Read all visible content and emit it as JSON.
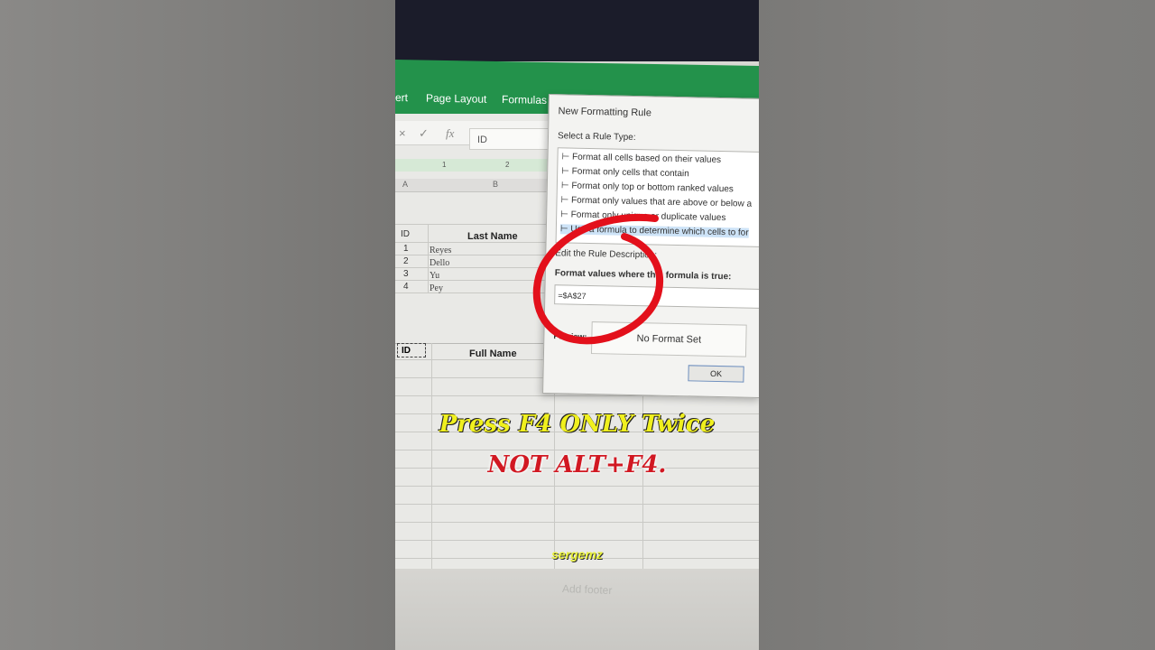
{
  "ribbon": {
    "tabs": [
      "ert",
      "Page Layout",
      "Formulas"
    ]
  },
  "formula_bar": {
    "cancel_icon": "×",
    "enter_icon": "✓",
    "fx_label": "fx",
    "value": "ID"
  },
  "ruler_marks": [
    "1",
    "2"
  ],
  "columns": [
    "A",
    "B"
  ],
  "table1": {
    "headers": [
      "ID",
      "Last Name"
    ],
    "rows": [
      {
        "id": "1",
        "last_name": "Reyes"
      },
      {
        "id": "2",
        "last_name": "Dello"
      },
      {
        "id": "3",
        "last_name": "Yu"
      },
      {
        "id": "4",
        "last_name": "Pey"
      }
    ]
  },
  "table2": {
    "headers": [
      "ID",
      "Full Name"
    ]
  },
  "dialog": {
    "title": "New Formatting Rule",
    "select_label": "Select a Rule Type:",
    "rule_types": [
      "Format all cells based on their values",
      "Format only cells that contain",
      "Format only top or bottom ranked values",
      "Format only values that are above or below a",
      "Format only unique or duplicate values",
      "Use a formula to determine which cells to for"
    ],
    "edit_label": "Edit the Rule Description:",
    "formula_label": "Format values where this formula is true:",
    "formula_value": "=$A$27",
    "preview_label": "Preview:",
    "preview_text": "No Format Set",
    "ok_label": "OK"
  },
  "captions": {
    "line1": "Press F4 ONLY  Twice",
    "line2": "NOT ALT+F4."
  },
  "watermark": "sergemz",
  "footer_hint": "Add footer",
  "colors": {
    "ribbon_green": "#23924b",
    "caption_yellow": "#f0f01e",
    "caption_red": "#d11822",
    "circle_red": "#e3101b"
  }
}
